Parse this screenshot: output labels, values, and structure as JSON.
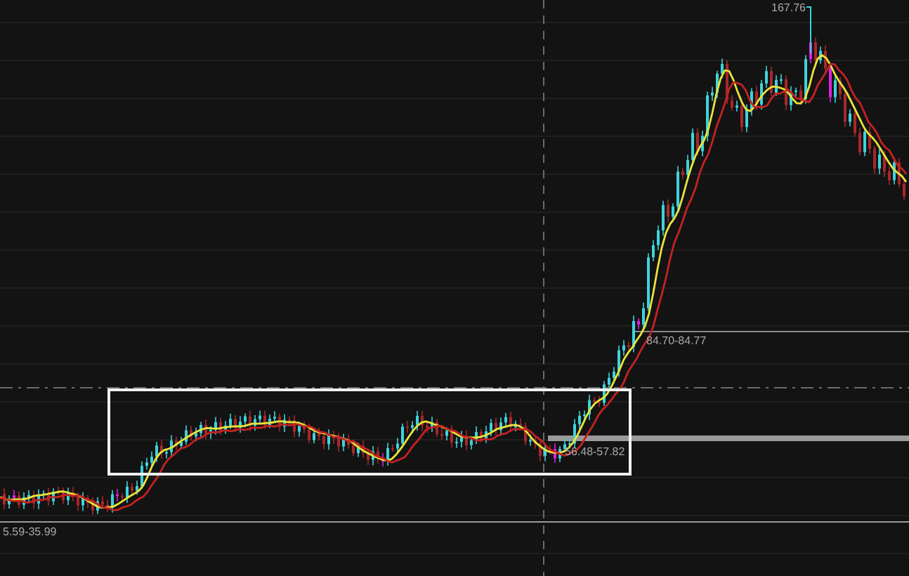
{
  "price_labels": [
    {
      "text": "167.76",
      "kind": "high"
    },
    {
      "text": "84.70-84.77",
      "kind": "range"
    },
    {
      "text": "56.48-57.82",
      "kind": "range"
    },
    {
      "text": "5.59-35.99",
      "kind": "range"
    }
  ],
  "moving_averages": [
    {
      "color": "#e8e43a"
    },
    {
      "color": "#c42222"
    }
  ]
}
